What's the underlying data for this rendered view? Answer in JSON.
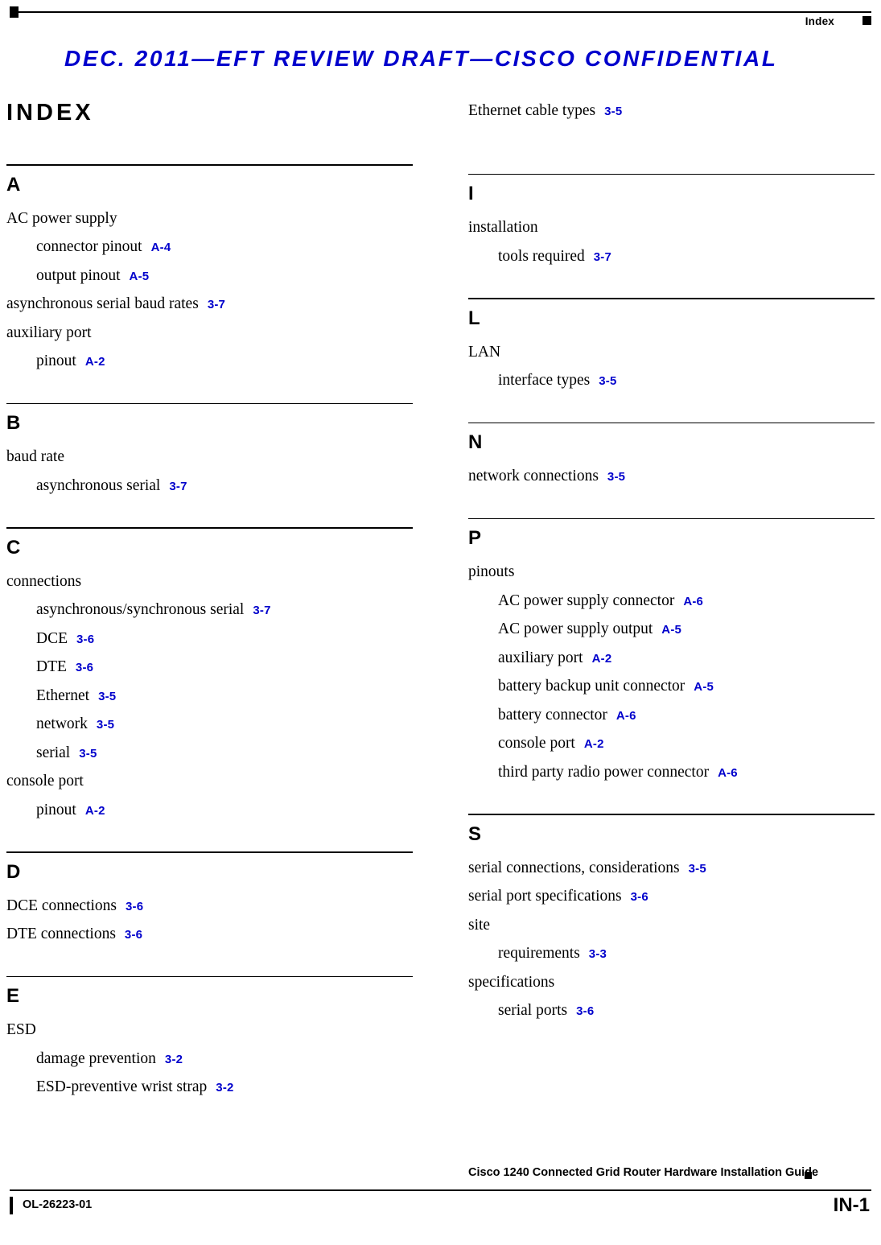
{
  "header": {
    "index_label": "Index",
    "draft_banner": "DEC. 2011—EFT REVIEW DRAFT—CISCO CONFIDENTIAL",
    "title": "INDEX"
  },
  "footer": {
    "guide_title": "Cisco 1240 Connected Grid Router Hardware Installation Guide",
    "doc_number": "OL-26223-01",
    "page_number": "IN-1"
  },
  "left_column": [
    {
      "letter": "A",
      "entries": [
        {
          "level": 1,
          "text": "AC power supply",
          "ref": ""
        },
        {
          "level": 2,
          "text": "connector pinout",
          "ref": "A-4"
        },
        {
          "level": 2,
          "text": "output pinout",
          "ref": "A-5"
        },
        {
          "level": 1,
          "text": "asynchronous serial baud rates",
          "ref": "3-7"
        },
        {
          "level": 1,
          "text": "auxiliary port",
          "ref": ""
        },
        {
          "level": 2,
          "text": "pinout",
          "ref": "A-2"
        }
      ]
    },
    {
      "letter": "B",
      "entries": [
        {
          "level": 1,
          "text": "baud rate",
          "ref": ""
        },
        {
          "level": 2,
          "text": "asynchronous serial",
          "ref": "3-7"
        }
      ]
    },
    {
      "letter": "C",
      "entries": [
        {
          "level": 1,
          "text": "connections",
          "ref": ""
        },
        {
          "level": 2,
          "text": "asynchronous/synchronous serial",
          "ref": "3-7"
        },
        {
          "level": 2,
          "text": "DCE",
          "ref": "3-6"
        },
        {
          "level": 2,
          "text": "DTE",
          "ref": "3-6"
        },
        {
          "level": 2,
          "text": "Ethernet",
          "ref": "3-5"
        },
        {
          "level": 2,
          "text": "network",
          "ref": "3-5"
        },
        {
          "level": 2,
          "text": "serial",
          "ref": "3-5"
        },
        {
          "level": 1,
          "text": "console port",
          "ref": ""
        },
        {
          "level": 2,
          "text": "pinout",
          "ref": "A-2"
        }
      ]
    },
    {
      "letter": "D",
      "entries": [
        {
          "level": 1,
          "text": "DCE connections",
          "ref": "3-6"
        },
        {
          "level": 1,
          "text": "DTE connections",
          "ref": "3-6"
        }
      ]
    },
    {
      "letter": "E",
      "entries": [
        {
          "level": 1,
          "text": "ESD",
          "ref": ""
        },
        {
          "level": 2,
          "text": "damage prevention",
          "ref": "3-2"
        },
        {
          "level": 2,
          "text": "ESD-preventive wrist strap",
          "ref": "3-2"
        }
      ]
    }
  ],
  "right_column_top": [
    {
      "level": 1,
      "text": "Ethernet cable types",
      "ref": "3-5"
    }
  ],
  "right_column": [
    {
      "letter": "I",
      "entries": [
        {
          "level": 1,
          "text": "installation",
          "ref": ""
        },
        {
          "level": 2,
          "text": "tools required",
          "ref": "3-7"
        }
      ]
    },
    {
      "letter": "L",
      "entries": [
        {
          "level": 1,
          "text": "LAN",
          "ref": ""
        },
        {
          "level": 2,
          "text": "interface types",
          "ref": "3-5"
        }
      ]
    },
    {
      "letter": "N",
      "entries": [
        {
          "level": 1,
          "text": "network connections",
          "ref": "3-5"
        }
      ]
    },
    {
      "letter": "P",
      "entries": [
        {
          "level": 1,
          "text": "pinouts",
          "ref": ""
        },
        {
          "level": 2,
          "text": "AC power supply connector",
          "ref": "A-6"
        },
        {
          "level": 2,
          "text": "AC power supply output",
          "ref": "A-5"
        },
        {
          "level": 2,
          "text": "auxiliary port",
          "ref": "A-2"
        },
        {
          "level": 2,
          "text": "battery backup unit connector",
          "ref": "A-5"
        },
        {
          "level": 2,
          "text": "battery connector",
          "ref": "A-6"
        },
        {
          "level": 2,
          "text": "console port",
          "ref": "A-2"
        },
        {
          "level": 2,
          "text": "third party radio power connector",
          "ref": "A-6"
        }
      ]
    },
    {
      "letter": "S",
      "entries": [
        {
          "level": 1,
          "text": "serial connections, considerations",
          "ref": "3-5"
        },
        {
          "level": 1,
          "text": "serial port specifications",
          "ref": "3-6"
        },
        {
          "level": 1,
          "text": "site",
          "ref": ""
        },
        {
          "level": 2,
          "text": "requirements",
          "ref": "3-3"
        },
        {
          "level": 1,
          "text": "specifications",
          "ref": ""
        },
        {
          "level": 2,
          "text": "serial ports",
          "ref": "3-6"
        }
      ]
    }
  ],
  "colors": {
    "page_ref": "#0000cc",
    "draft_banner": "#0000cc",
    "text": "#000000"
  }
}
